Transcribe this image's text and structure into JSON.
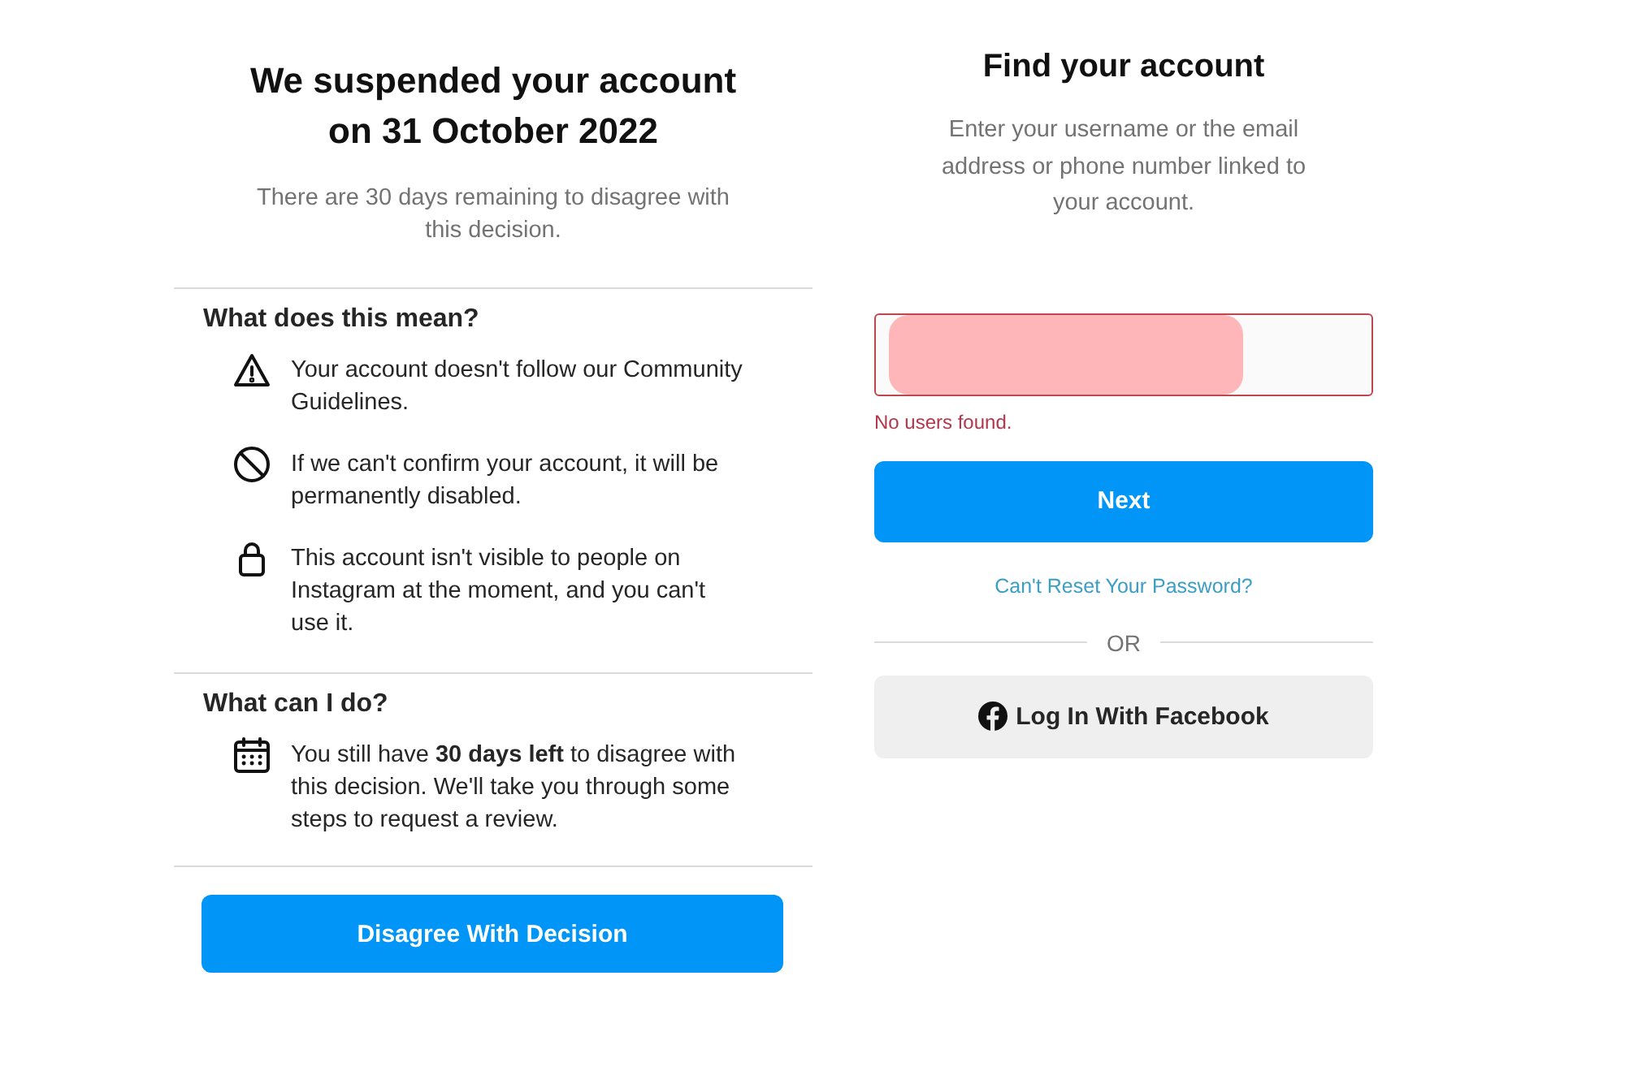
{
  "suspension": {
    "title_lines": [
      "We suspended your account",
      "on 31 October 2022"
    ],
    "subtitle": "There are 30 days remaining to disagree with this decision.",
    "sections": [
      {
        "heading": "What does this mean?",
        "items": [
          {
            "kind": "warning",
            "text": "Your account doesn't follow our Community Guidelines."
          },
          {
            "kind": "blocked",
            "text": "If we can't confirm your account, it will be permanently disabled."
          },
          {
            "kind": "lock",
            "text": "This account isn't visible to people on Instagram at the moment, and you can't use it."
          }
        ]
      },
      {
        "heading": "What can I do?",
        "items": [
          {
            "kind": "calendar",
            "text": "You still have **30 days left** to disagree with this decision. We'll take you through some steps to request a review."
          }
        ]
      }
    ],
    "button": "Disagree With Decision"
  },
  "find_account": {
    "title": "Find your account",
    "subtitle": "Enter your username or the email address or phone number linked to your account.",
    "field": {
      "redacted": true,
      "error": "No users found."
    },
    "next_button": "Next",
    "link": "Can't Reset Your Password?",
    "divider": "OR",
    "facebook_button": "Log In With Facebook"
  }
}
